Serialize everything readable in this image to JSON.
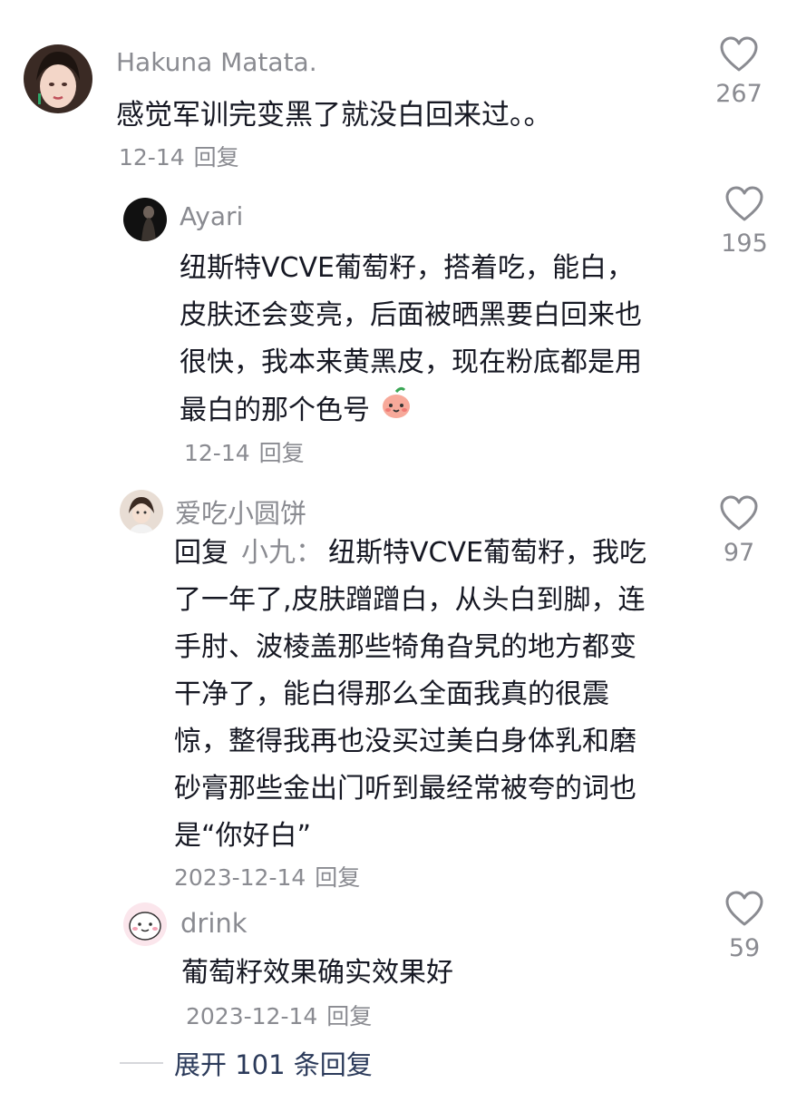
{
  "comments": [
    {
      "username": "Hakuna Matata.",
      "text": "感觉军训完变黑了就没白回来过。。",
      "date": "12-14",
      "reply_label": "回复",
      "likes": "267",
      "avatar_icon": "profile-photo-woman"
    },
    {
      "username": "Ayari",
      "text": "纽斯特VCVE葡萄籽，搭着吃，能白，皮肤还会变亮，后面被晒黑要白回来也很快，我本来黄黑皮，现在粉底都是用最白的那个色号",
      "emoji": "peach-face-emoji",
      "date": "12-14",
      "reply_label": "回复",
      "likes": "195",
      "avatar_icon": "profile-photo-dark"
    },
    {
      "username": "爱吃小圆饼",
      "reply_prefix": "回复",
      "reply_to": "小九：",
      "text": "纽斯特VCVE葡萄籽，我吃了一年了,皮肤蹭蹭白，从头白到脚，连手肘、波棱盖那些犄角旮旯的地方都变干净了，能白得那么全面我真的很震惊，整得我再也没买过美白身体乳和磨砂膏那些金出门听到最经常被夸的词也是“你好白”",
      "date": "2023-12-14",
      "reply_label": "回复",
      "likes": "97",
      "avatar_icon": "profile-photo-girl"
    },
    {
      "username": "drink",
      "text": "葡萄籽效果确实效果好",
      "date": "2023-12-14",
      "reply_label": "回复",
      "likes": "59",
      "avatar_icon": "cartoon-face-avatar"
    }
  ],
  "expand_replies": "展开 101 条回复",
  "colors": {
    "text": "#161823",
    "muted": "#8a8b91",
    "expand": "#2b3a5a"
  }
}
